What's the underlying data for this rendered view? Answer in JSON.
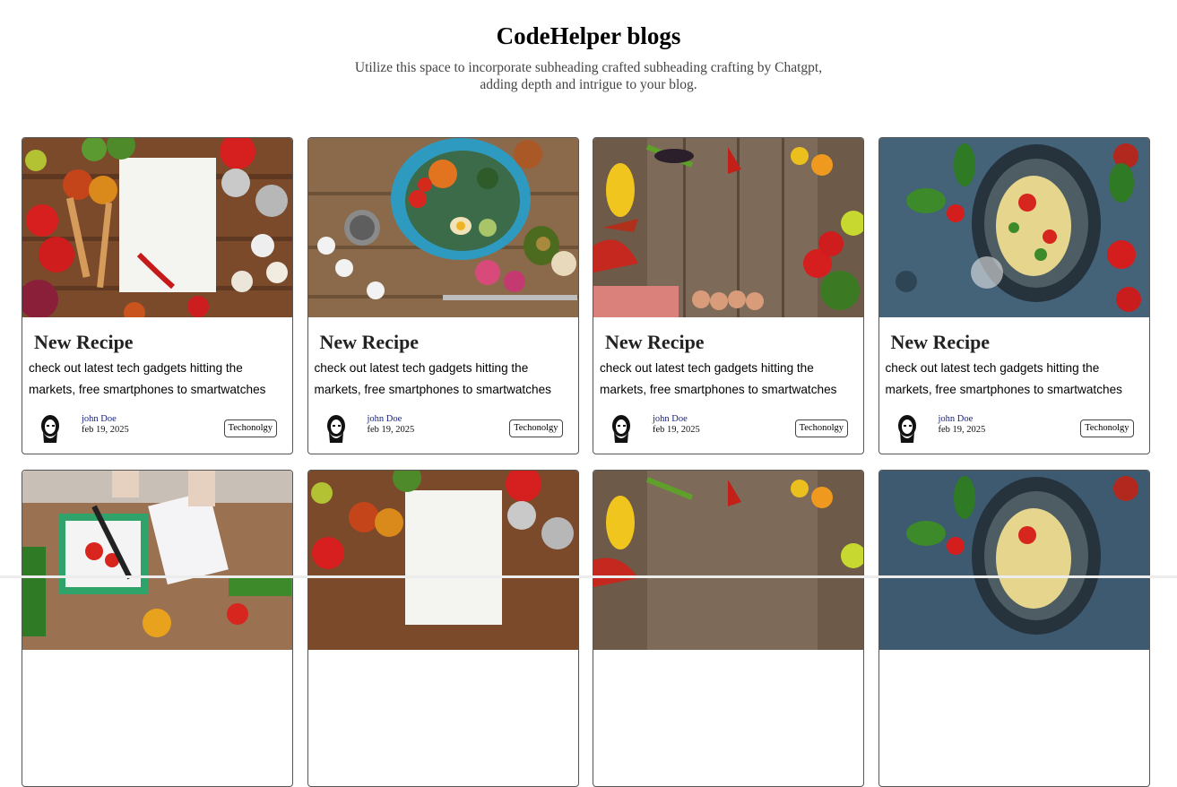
{
  "header": {
    "title": "CodeHelper blogs",
    "subtitle": "Utilize this space to incorporate subheading crafted subheading crafting by Chatgpt, adding depth and intrigue to your blog."
  },
  "cards": [
    {
      "image": "spices-notepad-image",
      "title": "New Recipe",
      "description": "check out latest tech gadgets hitting the markets, free smartphones to smartwatches",
      "author": "john Doe",
      "date": "feb 19, 2025",
      "tag": "Techonolgy"
    },
    {
      "image": "salad-bowl-image",
      "title": "New Recipe",
      "description": "check out latest tech gadgets hitting the markets, free smartphones to smartwatches",
      "author": "john Doe",
      "date": "feb 19, 2025",
      "tag": "Techonolgy"
    },
    {
      "image": "vegetables-wood-image",
      "title": "New Recipe",
      "description": "check out latest tech gadgets hitting the markets, free smartphones to smartwatches",
      "author": "john Doe",
      "date": "feb 19, 2025",
      "tag": "Techonolgy"
    },
    {
      "image": "pasta-plate-image",
      "title": "New Recipe",
      "description": "check out latest tech gadgets hitting the markets, free smartphones to smartwatches",
      "author": "john Doe",
      "date": "feb 19, 2025",
      "tag": "Techonolgy"
    },
    {
      "image": "cutting-board-image"
    },
    {
      "image": "spices-notepad-image"
    },
    {
      "image": "vegetables-wood-image"
    },
    {
      "image": "pasta-plate-image"
    }
  ]
}
